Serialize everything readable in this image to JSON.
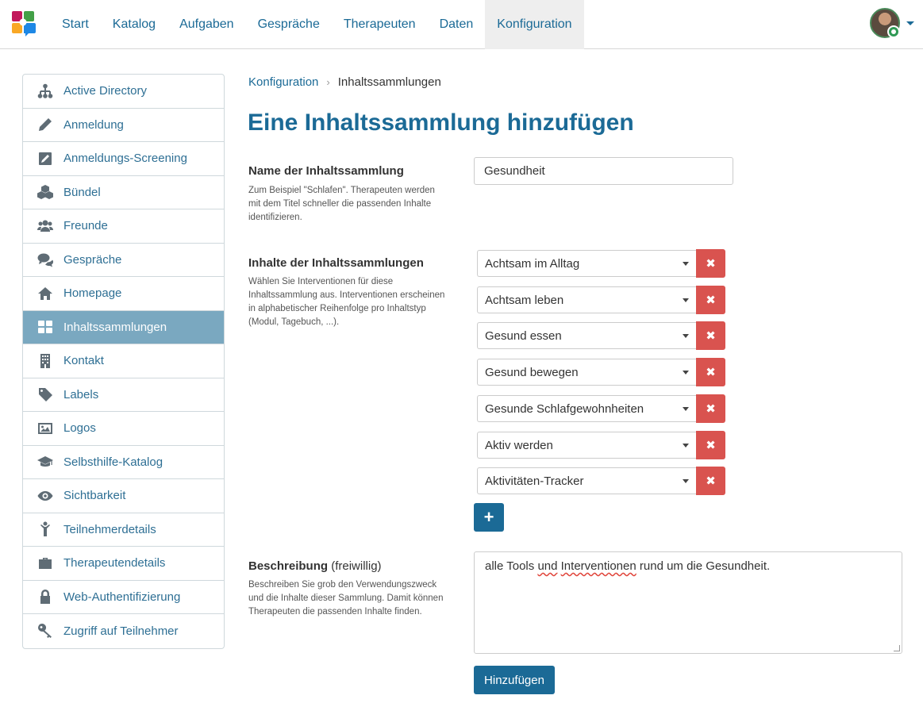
{
  "nav": {
    "items": [
      "Start",
      "Katalog",
      "Aufgaben",
      "Gespräche",
      "Therapeuten",
      "Daten",
      "Konfiguration"
    ],
    "active": "Konfiguration"
  },
  "sidebar": {
    "items": [
      {
        "label": "Active Directory",
        "icon": "sitemap-icon"
      },
      {
        "label": "Anmeldung",
        "icon": "pencil-icon"
      },
      {
        "label": "Anmeldungs-Screening",
        "icon": "edit-square-icon"
      },
      {
        "label": "Bündel",
        "icon": "cubes-icon"
      },
      {
        "label": "Freunde",
        "icon": "users-icon"
      },
      {
        "label": "Gespräche",
        "icon": "comments-icon"
      },
      {
        "label": "Homepage",
        "icon": "home-icon"
      },
      {
        "label": "Inhaltssammlungen",
        "icon": "th-large-icon"
      },
      {
        "label": "Kontakt",
        "icon": "building-icon"
      },
      {
        "label": "Labels",
        "icon": "tag-icon"
      },
      {
        "label": "Logos",
        "icon": "image-icon"
      },
      {
        "label": "Selbsthilfe-Katalog",
        "icon": "graduation-cap-icon"
      },
      {
        "label": "Sichtbarkeit",
        "icon": "eye-icon"
      },
      {
        "label": "Teilnehmerdetails",
        "icon": "child-icon"
      },
      {
        "label": "Therapeutendetails",
        "icon": "briefcase-icon"
      },
      {
        "label": "Web-Authentifizierung",
        "icon": "lock-icon"
      },
      {
        "label": "Zugriff auf Teilnehmer",
        "icon": "key-icon"
      }
    ],
    "active_index": 7
  },
  "breadcrumb": {
    "parent": "Konfiguration",
    "current": "Inhaltssammlungen"
  },
  "page_title": "Eine Inhaltssammlung hinzufügen",
  "form": {
    "name": {
      "label": "Name der Inhaltssammlung",
      "help": "Zum Beispiel \"Schlafen\". Therapeuten werden mit dem Titel schneller die passenden Inhalte identifizieren.",
      "value": "Gesundheit"
    },
    "contents": {
      "label": "Inhalte der Inhaltssammlungen",
      "help": "Wählen Sie Interventionen für diese Inhaltssammlung aus. Interventionen erscheinen in alphabetischer Reihenfolge pro Inhaltstyp (Modul, Tagebuch, ...).",
      "items": [
        "Achtsam im Alltag",
        "Achtsam leben",
        "Gesund essen",
        "Gesund bewegen",
        "Gesunde Schlafgewohnheiten",
        "Aktiv werden",
        "Aktivitäten-Tracker"
      ],
      "remove_symbol": "✖",
      "add_symbol": "+"
    },
    "description": {
      "label": "Beschreibung",
      "optional": "(freiwillig)",
      "help": "Beschreiben Sie grob den Verwendungszweck und die Inhalte dieser Sammlung. Damit können Therapeuten die passenden Inhalte finden.",
      "value_parts": [
        "alle Tools ",
        "und",
        " ",
        "Interventionen",
        " rund um die Gesundheit."
      ]
    },
    "submit_label": "Hinzufügen"
  },
  "colors": {
    "primary": "#1b6a96",
    "danger": "#d9534f",
    "sidebar_active": "#7aa8c0"
  }
}
